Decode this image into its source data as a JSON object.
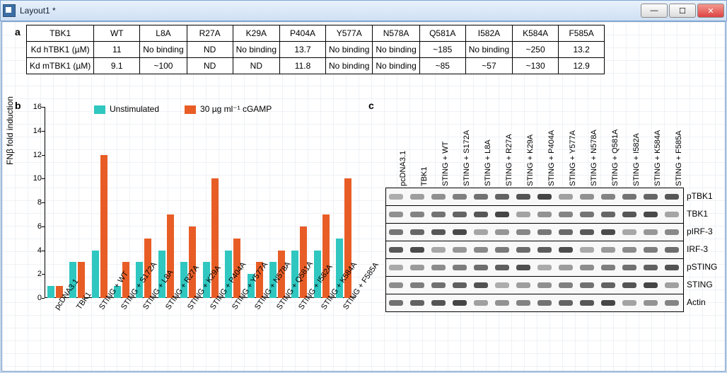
{
  "window": {
    "title": "Layout1 *"
  },
  "winbtns": {
    "min": "—",
    "max": "☐",
    "close": "✕"
  },
  "panel_labels": {
    "a": "a",
    "b": "b",
    "c": "c"
  },
  "table": {
    "headers": [
      "TBK1",
      "WT",
      "L8A",
      "R27A",
      "K29A",
      "P404A",
      "Y577A",
      "N578A",
      "Q581A",
      "I582A",
      "K584A",
      "F585A"
    ],
    "rows": [
      {
        "label": "Kd hTBK1 (µM)",
        "cells": [
          "11",
          "No binding",
          "ND",
          "No binding",
          "13.7",
          "No binding",
          "No binding",
          "~185",
          "No binding",
          "~250",
          "13.2"
        ]
      },
      {
        "label": "Kd mTBK1 (µM)",
        "cells": [
          "9.1",
          "~100",
          "ND",
          "ND",
          "11.8",
          "No binding",
          "No binding",
          "~85",
          "~57",
          "~130",
          "12.9"
        ]
      }
    ]
  },
  "legend": {
    "unstim": "Unstimulated",
    "stim": "30 µg ml⁻¹ cGAMP"
  },
  "chart_ylabel": "FNβ fold induction",
  "chart_data": {
    "type": "bar",
    "ylabel": "FNβ fold induction",
    "ylim": [
      0,
      16
    ],
    "yticks": [
      0,
      2,
      4,
      6,
      8,
      10,
      12,
      14,
      16
    ],
    "categories": [
      "pcDNA3.1",
      "TBK1",
      "STING + WT",
      "STING + S172A",
      "STING + L8A",
      "STING + R27A",
      "STING + K29A",
      "STING + P404A",
      "STING + Y577A",
      "STING + N578A",
      "STING + Q581A",
      "STING + I582A",
      "STING + K584A",
      "STING + F585A"
    ],
    "series": [
      {
        "name": "Unstimulated",
        "values": [
          1,
          3,
          4,
          1,
          3,
          4,
          3,
          3,
          4,
          2,
          3,
          4,
          4,
          5
        ]
      },
      {
        "name": "30 µg ml⁻¹ cGAMP",
        "values": [
          1,
          3,
          12,
          3,
          5,
          7,
          6,
          10,
          5,
          3,
          4,
          6,
          7,
          10
        ]
      }
    ]
  },
  "panc_lanes": [
    "pcDNA3.1",
    "TBK1",
    "STING + WT",
    "STING + S172A",
    "STING + L8A",
    "STING + R27A",
    "STING + K29A",
    "STING + P404A",
    "STING + Y577A",
    "STING + N578A",
    "STING + Q581A",
    "STING + I582A",
    "STING + K584A",
    "STING + F585A"
  ],
  "panc_rows": [
    "pTBK1",
    "TBK1",
    "pIRF-3",
    "IRF-3",
    "pSTING",
    "STING",
    "Actin"
  ]
}
